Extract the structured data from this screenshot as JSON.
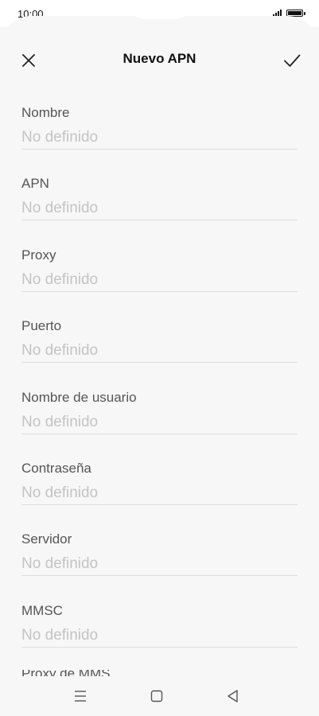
{
  "status_bar": {
    "time": "10:00",
    "icons": [
      "signal-icon",
      "battery-icon"
    ]
  },
  "header": {
    "title": "Nuevo APN",
    "close_icon": "close-icon",
    "confirm_icon": "checkmark-icon"
  },
  "form": {
    "fields": [
      {
        "label": "Nombre",
        "placeholder": "No definido",
        "value": ""
      },
      {
        "label": "APN",
        "placeholder": "No definido",
        "value": ""
      },
      {
        "label": "Proxy",
        "placeholder": "No definido",
        "value": ""
      },
      {
        "label": "Puerto",
        "placeholder": "No definido",
        "value": ""
      },
      {
        "label": "Nombre de usuario",
        "placeholder": "No definido",
        "value": ""
      },
      {
        "label": "Contraseña",
        "placeholder": "No definido",
        "value": ""
      },
      {
        "label": "Servidor",
        "placeholder": "No definido",
        "value": ""
      },
      {
        "label": "MMSC",
        "placeholder": "No definido",
        "value": ""
      }
    ],
    "next_field_partial_label": "Proxy de MMS"
  },
  "nav_bar": {
    "items": [
      "menu-icon",
      "home-icon",
      "back-icon"
    ]
  },
  "colors": {
    "background": "#f7f7f7",
    "text_primary": "#111111",
    "label": "#555555",
    "placeholder": "#c4c4c4",
    "divider": "#dedede"
  }
}
